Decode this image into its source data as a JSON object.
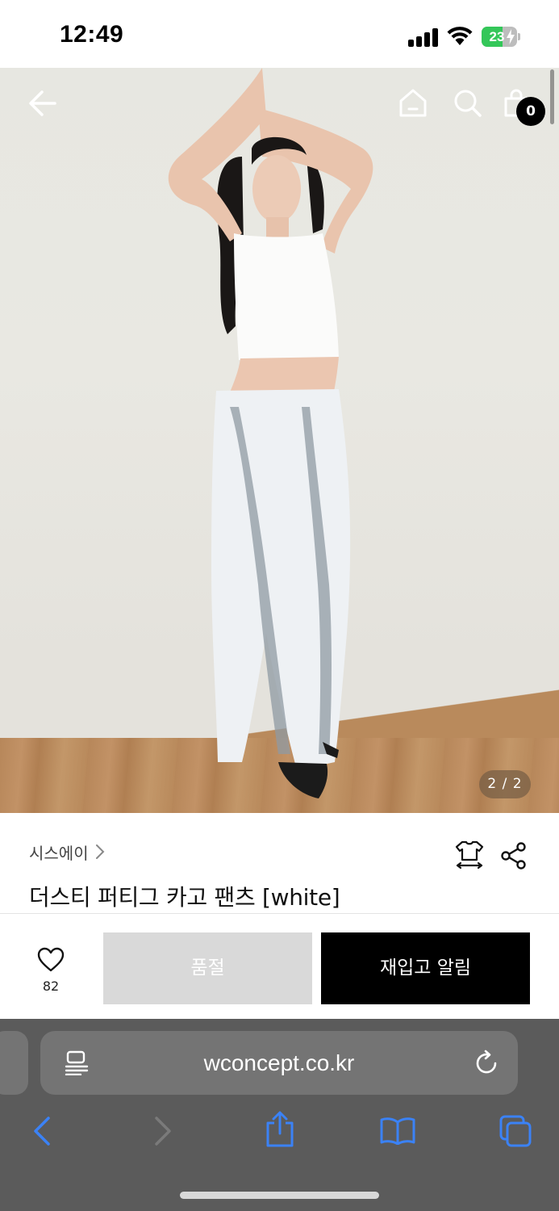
{
  "status_bar": {
    "time": "12:49",
    "battery_level": "23",
    "battery_color": "#34c759"
  },
  "hero": {
    "icons": [
      "back-arrow-icon",
      "home-icon",
      "search-icon",
      "shopping-bag-icon"
    ],
    "cart_count": "0",
    "page_indicator": "2 / 2"
  },
  "product": {
    "brand": "시스에이",
    "title": "더스티 퍼티그 카고 팬츠 [white]",
    "icons": [
      "size-guide-icon",
      "share-icon"
    ]
  },
  "purchase_bar": {
    "like_count": "82",
    "soldout_label": "품절",
    "restock_label": "재입고 알림",
    "soldout_color": "#d9d9d9",
    "restock_color": "#000000"
  },
  "browser": {
    "url": "wconcept.co.kr",
    "toolbar_icons": [
      "back-icon",
      "forward-icon",
      "share-icon",
      "bookmarks-icon",
      "tabs-icon"
    ],
    "accent_color": "#3b82f6"
  }
}
